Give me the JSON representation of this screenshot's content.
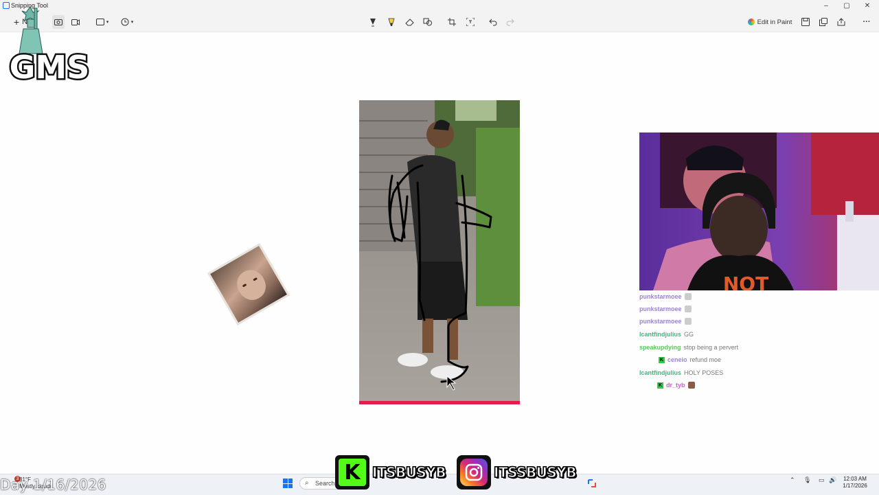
{
  "window": {
    "title": "Snipping Tool",
    "minimize": "–",
    "maximize": "▢",
    "close": "✕"
  },
  "toolbar": {
    "new_label": "New",
    "edit_in_paint_label": "Edit in Paint",
    "more_label": "···"
  },
  "logo": {
    "text": "GMS"
  },
  "chat": [
    {
      "user": "punkstarmoee",
      "message": "",
      "style": "purple",
      "badge": false,
      "emote": true
    },
    {
      "user": "punkstarmoee",
      "message": "",
      "style": "purple",
      "badge": false,
      "emote": true
    },
    {
      "user": "punkstarmoee",
      "message": "",
      "style": "purple",
      "badge": false,
      "emote": true
    },
    {
      "user": "lcantfindjulius",
      "message": "GG",
      "style": "green",
      "badge": false,
      "emote": false
    },
    {
      "user": "speakupdying",
      "message": "stop being a pervert",
      "style": "lime",
      "badge": false,
      "emote": false
    },
    {
      "user": "ceneio",
      "message": "refund moe",
      "style": "purple",
      "badge": true,
      "emote": false
    },
    {
      "user": "lcantfindjulius",
      "message": "HOLY POSES",
      "style": "green",
      "badge": false,
      "emote": false
    },
    {
      "user": "dr_tyb",
      "message": "",
      "style": "pink",
      "badge": true,
      "emote": true
    }
  ],
  "overlay": {
    "date_text": "Day 1/16/2026",
    "kick_letter": "K",
    "kick_handle": "ITSBUSYB",
    "instagram_handle": "ITSSBUSYB"
  },
  "taskbar": {
    "weather_temp": "31°F",
    "weather_desc": "Mostly cloudy",
    "weather_badge": "3",
    "search_label": "Search",
    "time": "12:03 AM",
    "date": "1/17/2026"
  },
  "colors": {
    "accent": "#1a73e8",
    "kick_green": "#53fc18",
    "title_bar": "#f3f3f3"
  }
}
